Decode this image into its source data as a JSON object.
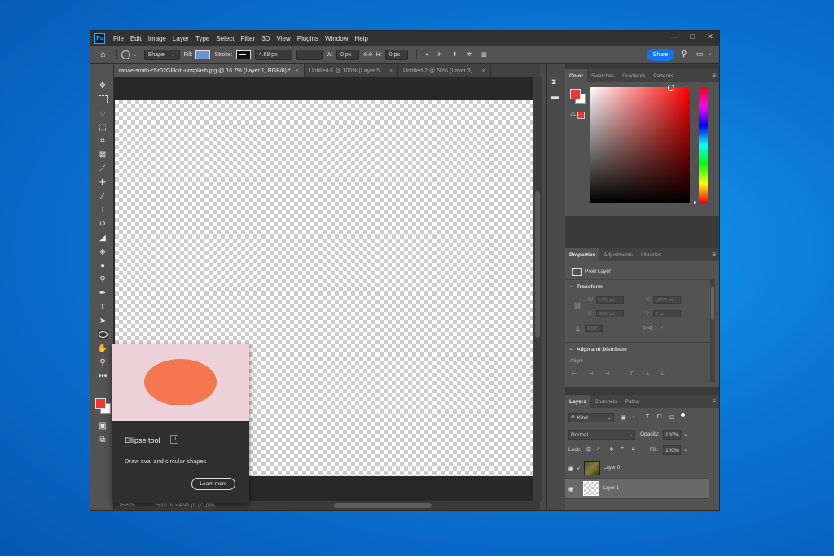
{
  "menubar": {
    "logo": "Ps",
    "items": [
      "File",
      "Edit",
      "Image",
      "Layer",
      "Type",
      "Select",
      "Filter",
      "3D",
      "View",
      "Plugins",
      "Window",
      "Help"
    ],
    "controls": [
      "—",
      "□",
      "✕"
    ]
  },
  "options": {
    "mode": "Shape",
    "fill_label": "Fill:",
    "stroke_label": "Stroke:",
    "stroke_width": "4.68 px",
    "w_label": "W:",
    "w_value": "0 px",
    "link": "⊖⊖",
    "h_label": "H:",
    "h_value": "0 px",
    "share": "Share",
    "fill_color": "#6b93d6"
  },
  "tabs": [
    {
      "label": "ranae-smith-c5z02GFkxtI-unsplash.jpg @ 16.7% (Layer 1, RGB/8) *",
      "close": "×"
    },
    {
      "label": "Untitled-1 @ 100% (Layer 5...",
      "close": "×"
    },
    {
      "label": "Untitled-2 @ 50% (Layer 3,...",
      "close": "×"
    }
  ],
  "tooltip": {
    "title": "Ellipse tool",
    "shortcut": "U",
    "description": "Draw oval and circular shapes",
    "button": "Learn more",
    "ellipse_color": "#f47750"
  },
  "statusbar": {
    "zoom": "16.67%",
    "doc_info": "5000 px x 4241 px (72 ppi)"
  },
  "color_panel": {
    "tabs": [
      "Color",
      "Swatches",
      "Gradients",
      "Patterns"
    ],
    "foreground": "#e83a33"
  },
  "properties_panel": {
    "tabs": [
      "Properties",
      "Adjustments",
      "Libraries"
    ],
    "kind": "Pixel Layer",
    "transform_heading": "Transform",
    "w_label": "W",
    "w_value": "5760 px",
    "x_label": "X",
    "x_value": "-2074 px",
    "h_label": "H",
    "h_value": "3880 px",
    "y_label": "Y",
    "y_value": "0 px",
    "angle_value": "0.00°",
    "align_heading": "Align and Distribute",
    "align_label": "Align:"
  },
  "layers_panel": {
    "tabs": [
      "Layers",
      "Channels",
      "Paths"
    ],
    "filter": "Kind",
    "blend_mode": "Normal",
    "opacity_label": "Opacity:",
    "opacity": "100%",
    "lock_label": "Lock:",
    "fill_label": "Fill:",
    "fill": "100%",
    "layers": [
      {
        "name": "Layer 0"
      },
      {
        "name": "Layer 1"
      }
    ]
  }
}
